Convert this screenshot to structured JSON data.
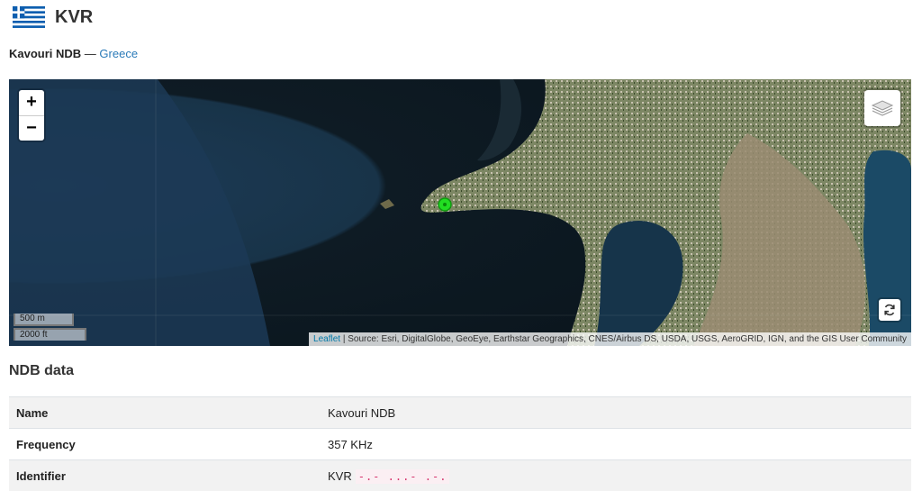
{
  "header": {
    "flag_icon": "greece-flag-icon",
    "code": "KVR"
  },
  "subtitle": {
    "name": "Kavouri NDB",
    "separator": " — ",
    "country": "Greece"
  },
  "map": {
    "zoom_in": "+",
    "zoom_out": "−",
    "layers_icon": "layers-icon",
    "refresh_icon": "refresh-icon",
    "scale_metric": "500 m",
    "scale_imperial": "2000 ft",
    "attribution_link": "Leaflet",
    "attribution_text": " | Source: Esri, DigitalGlobe, GeoEye, Earthstar Geographics, CNES/Airbus DS, USDA, USGS, AeroGRID, IGN, and the GIS User Community",
    "marker_color": "#22dd22"
  },
  "section": {
    "title": "NDB data"
  },
  "table": {
    "rows": [
      {
        "label": "Name",
        "value": "Kavouri NDB",
        "extra": ""
      },
      {
        "label": "Frequency",
        "value": "357 KHz",
        "extra": ""
      },
      {
        "label": "Identifier",
        "value": "KVR",
        "extra": "-.- ...- .-."
      }
    ]
  }
}
